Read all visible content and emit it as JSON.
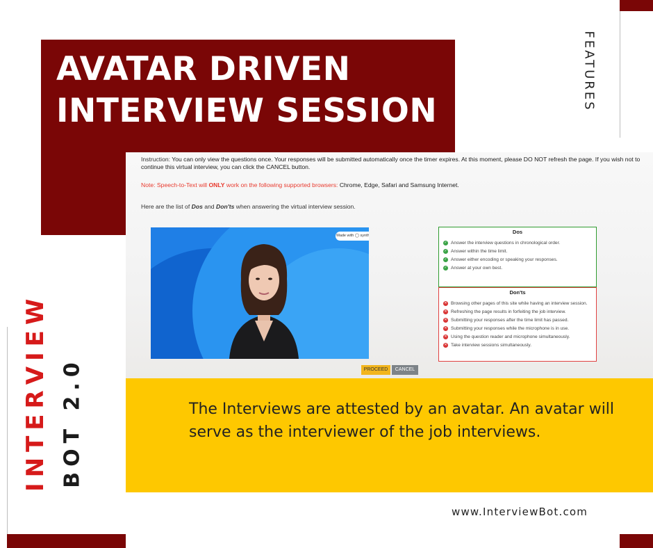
{
  "title": {
    "line1": "AVATAR DRIVEN",
    "line2": "INTERVIEW SESSION"
  },
  "side_label": "FEATURES",
  "brand": {
    "name": "INTERVIEW",
    "version": "BOT 2.0"
  },
  "screen": {
    "instruction_prefix": "Instruction:",
    "instruction_text": "You can only view the questions once. Your responses will be submitted automatically once the timer expires. At this moment, please DO NOT refresh the page. If you wish not to continue this virtual interview, you can click the CANCEL button.",
    "note_prefix": "Note: Speech-to-Text will",
    "note_only": "ONLY",
    "note_middle": "work on the following supported browsers:",
    "note_browsers": "Chrome, Edge, Safari and Samsung Internet.",
    "dos_intro_1": "Here are the list of",
    "dos_word": "Dos",
    "dos_intro_and": "and",
    "donts_word": "Don'ts",
    "dos_intro_2": "when answering the virtual interview session.",
    "video_badge": "Made with ◯ synthesia",
    "dos_title": "Dos",
    "dos": [
      "Answer the interview questions in chronological order.",
      "Answer within the time limit.",
      "Answer either encoding or speaking your responses.",
      "Answer at your own best."
    ],
    "donts_title": "Don'ts",
    "donts": [
      "Browsing other pages of this site while having an interview session.",
      "Refreshing the page results in forfeiting the job interview.",
      "Submitting your responses after the time limit has passed.",
      "Submitting your responses while the microphone is in use.",
      "Using the question reader and microphone simultaneously.",
      "Take interview sessions simultaneously."
    ],
    "proceed_label": "PROCEED",
    "cancel_label": "CANCEL"
  },
  "description": "The Interviews are attested by an avatar. An avatar will serve as the interviewer of the job interviews.",
  "website": "www.InterviewBot.com",
  "colors": {
    "maroon": "#7a0606",
    "yellow": "#fec800",
    "red": "#d61a1a",
    "dos_green": "#2f9b2f",
    "donts_red": "#e04040"
  }
}
